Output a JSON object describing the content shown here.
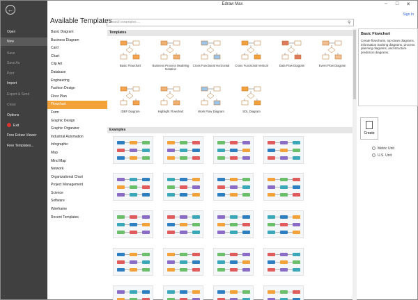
{
  "app_title": "Edraw Max",
  "sign_in": "Sign In",
  "window_controls": [
    "–",
    "□",
    "✕"
  ],
  "left_panel": {
    "items": [
      {
        "label": "Open",
        "state": "normal"
      },
      {
        "label": "New",
        "state": "active"
      },
      {
        "label": "Save",
        "state": "dim"
      },
      {
        "label": "Save As",
        "state": "dim"
      },
      {
        "label": "Print",
        "state": "dim"
      },
      {
        "label": "Import",
        "state": "normal"
      },
      {
        "label": "Export & Send",
        "state": "dim"
      },
      {
        "label": "Close",
        "state": "dim"
      },
      {
        "label": "Options",
        "state": "normal"
      },
      {
        "label": "Exit",
        "state": "normal"
      },
      {
        "label": "Free Edraw Viewer",
        "state": "normal"
      },
      {
        "label": "Free Templates...",
        "state": "normal"
      }
    ]
  },
  "main": {
    "heading": "Available Templates",
    "search_placeholder": "Search examples ..."
  },
  "categories": [
    "Basic Diagram",
    "Business Diagram",
    "Card",
    "Chart",
    "Clip Art",
    "Database",
    "Engineering",
    "Fashion Design",
    "Floor Plan",
    "Flowchart",
    "Form",
    "Graphic Design",
    "Graphic Organizer",
    "Industrial Automation",
    "Infographic",
    "Map",
    "Mind Map",
    "Network",
    "Organizational Chart",
    "Project Management",
    "Science",
    "Software",
    "Wireframe",
    "Recent Templates"
  ],
  "selected_category": "Flowchart",
  "sections": {
    "templates": "Templates",
    "examples": "Examples"
  },
  "templates": [
    "Basic Flowchart",
    "Business Process Modeling Notation",
    "Cross Functional Horizontal",
    "Cross Functional Vertical",
    "Data Flow Diagram",
    "Event Flow Diagram",
    "IDEF Diagram",
    "Highlight Flowchart",
    "Work Flow Diagram",
    "SDL Diagram"
  ],
  "right_panel": {
    "title": "Basic Flowchart",
    "description": "Create flowcharts, top-down diagrams, information tracking diagrams, process planning diagrams, and structure prediction diagrams.",
    "create_label": "Create",
    "units": [
      "Metric Unit",
      "U.S. Unit"
    ]
  },
  "colors": {
    "sidebar_bg": "#404040",
    "accent_orange": "#f3a23a",
    "link_blue": "#2b5fd9"
  }
}
